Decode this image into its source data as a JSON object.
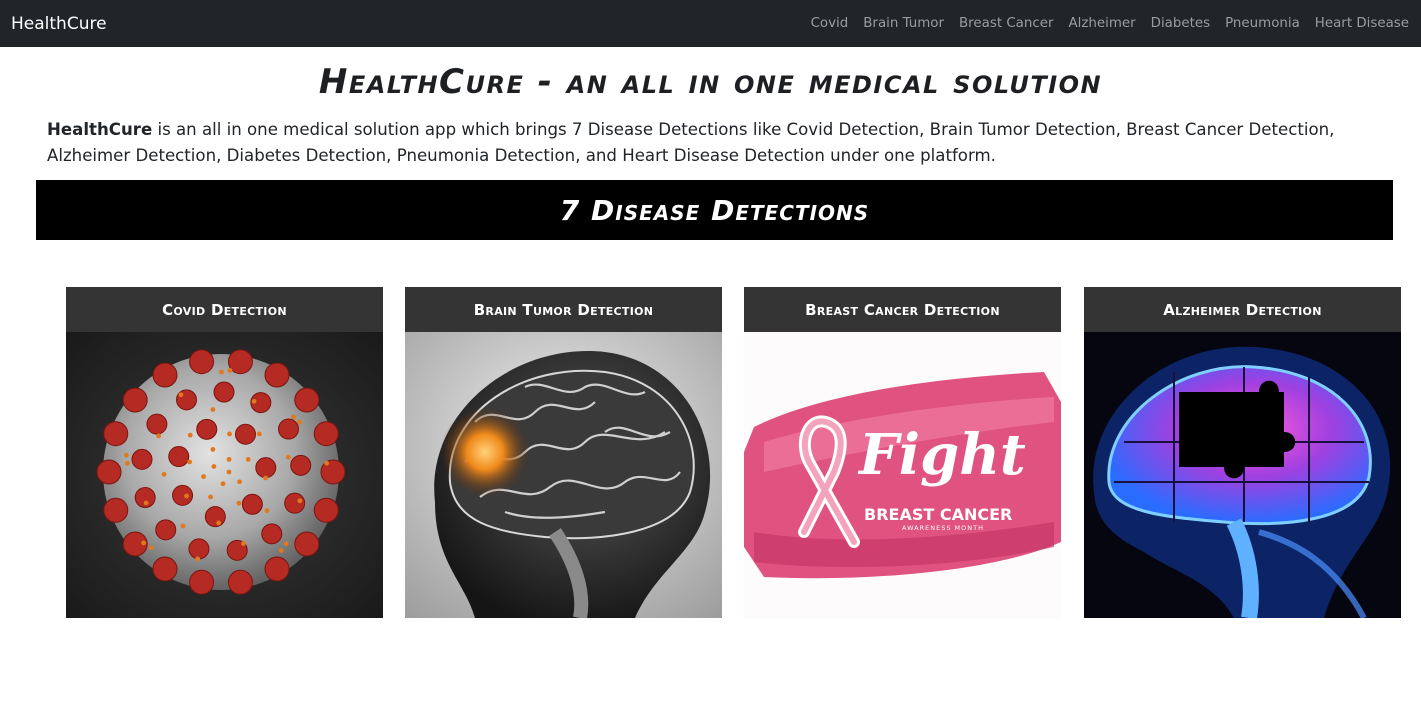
{
  "navbar": {
    "brand": "HealthCure",
    "links": [
      "Covid",
      "Brain Tumor",
      "Breast Cancer",
      "Alzheimer",
      "Diabetes",
      "Pneumonia",
      "Heart Disease"
    ]
  },
  "page_title": "HealthCure - an all in one medical solution",
  "intro": {
    "brand": "HealthCure",
    "text": " is an all in one medical solution app which brings 7 Disease Detections like Covid Detection, Brain Tumor Detection, Breast Cancer Detection, Alzheimer Detection, Diabetes Detection, Pneumonia Detection, and Heart Disease Detection under one platform."
  },
  "banner_title": "7 Disease Detections",
  "cards": [
    {
      "title": "Covid Detection"
    },
    {
      "title": "Brain Tumor Detection"
    },
    {
      "title": "Breast Cancer Detection",
      "image_text": {
        "headline": "Fight",
        "line1": "BREAST CANCER",
        "line2": "AWARENESS MONTH"
      }
    },
    {
      "title": "Alzheimer Detection"
    }
  ],
  "colors": {
    "navbar_bg": "#212529",
    "card_header_bg": "#343434",
    "banner_bg": "#000000"
  }
}
